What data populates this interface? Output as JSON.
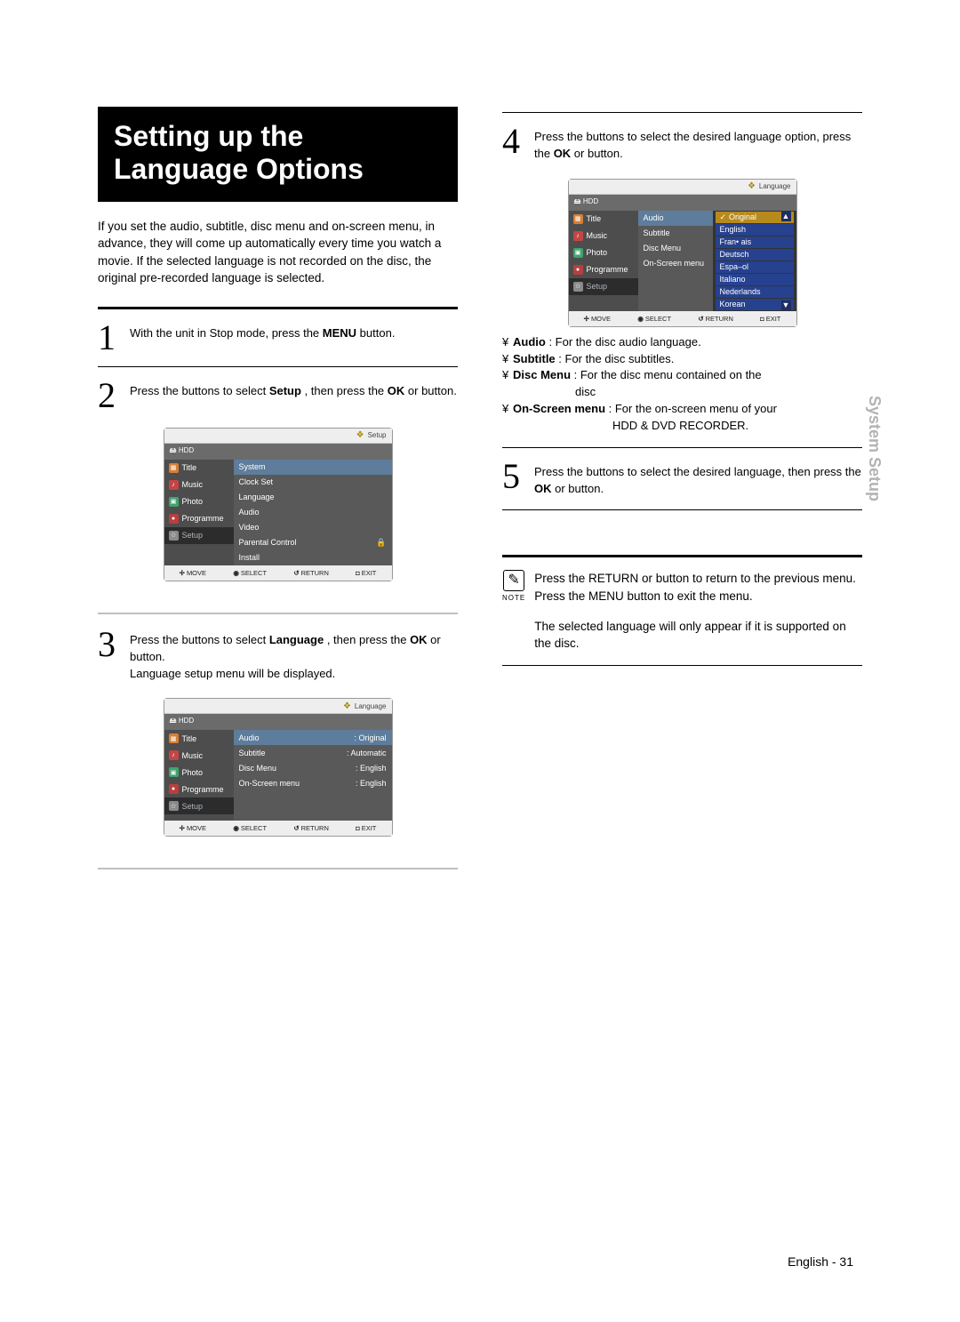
{
  "title": "Setting up the Language Options",
  "intro": "If you set the audio, subtitle, disc menu and on-screen menu, in advance, they will come up automatically every time you watch a movie.\nIf the selected language is not recorded on the disc, the original pre-recorded language is selected.",
  "step1": {
    "num": "1",
    "text_a": "With the unit in Stop mode, press the ",
    "menu": "MENU",
    "text_b": " button."
  },
  "step2": {
    "num": "2",
    "a": "Press the ",
    "b": " buttons to select ",
    "setup": "Setup",
    "c": " , then press the ",
    "ok": "OK",
    "d": " or ",
    "e": " button."
  },
  "step3": {
    "num": "3",
    "a": "Press the ",
    "b": " buttons to select ",
    "lang": "Language",
    "c": " , then press the ",
    "ok": "OK",
    "d": " or ",
    "e": " button.",
    "f": "Language setup menu will be displayed."
  },
  "step4": {
    "num": "4",
    "a": "Press the ",
    "b": " buttons to select the desired language option, press the ",
    "ok": "OK",
    "c": " or ",
    "d": " button."
  },
  "step5": {
    "num": "5",
    "a": "Press the ",
    "b": " buttons to select the desired language, then press the ",
    "ok": "OK",
    "c": " or ",
    "d": " button."
  },
  "defs": {
    "audio": {
      "bullet": "¥",
      "label": "Audio  ",
      "text": ": For the disc audio language."
    },
    "sub": {
      "bullet": "¥",
      "label": "Subtitle  ",
      "text": ": For the disc subtitles."
    },
    "disc": {
      "bullet": "¥",
      "label": "Disc Menu ",
      "text_a": ": For the disc menu contained on the",
      "text_b": "disc"
    },
    "onsc": {
      "bullet": "¥",
      "label": "On-Screen menu ",
      "text_a": ": For the on-screen menu of your",
      "text_b": "HDD & DVD RECORDER."
    }
  },
  "note": {
    "icon": "✎",
    "label": "NOTE",
    "p1": "Press the RETURN or        button to return to the previous menu. Press the MENU button to exit the menu.",
    "p2": "The selected language will only appear if it is supported on the disc."
  },
  "side_tab": "System Setup",
  "footer": "English - 31",
  "osd": {
    "hdd": "HDD",
    "side": [
      "Title",
      "Music",
      "Photo",
      "Programme",
      "Setup"
    ],
    "setup_title": "Setup",
    "lang_title": "Language",
    "setup_rows": [
      "System",
      "Clock Set",
      "Language",
      "Audio",
      "Video",
      "Parental Control",
      "Install"
    ],
    "lang_rows": [
      {
        "k": "Audio",
        "v": ": Original"
      },
      {
        "k": "Subtitle",
        "v": ": Automatic"
      },
      {
        "k": "Disc Menu",
        "v": ": English"
      },
      {
        "k": "On-Screen menu",
        "v": ": English"
      }
    ],
    "lang_opts": [
      "Original",
      "English",
      "Fran• ais",
      "Deutsch",
      "Espa–ol",
      "Italiano",
      "Nederlands",
      "Korean"
    ],
    "bot": {
      "move": "MOVE",
      "select": "SELECT",
      "return": "RETURN",
      "exit": "EXIT"
    }
  }
}
